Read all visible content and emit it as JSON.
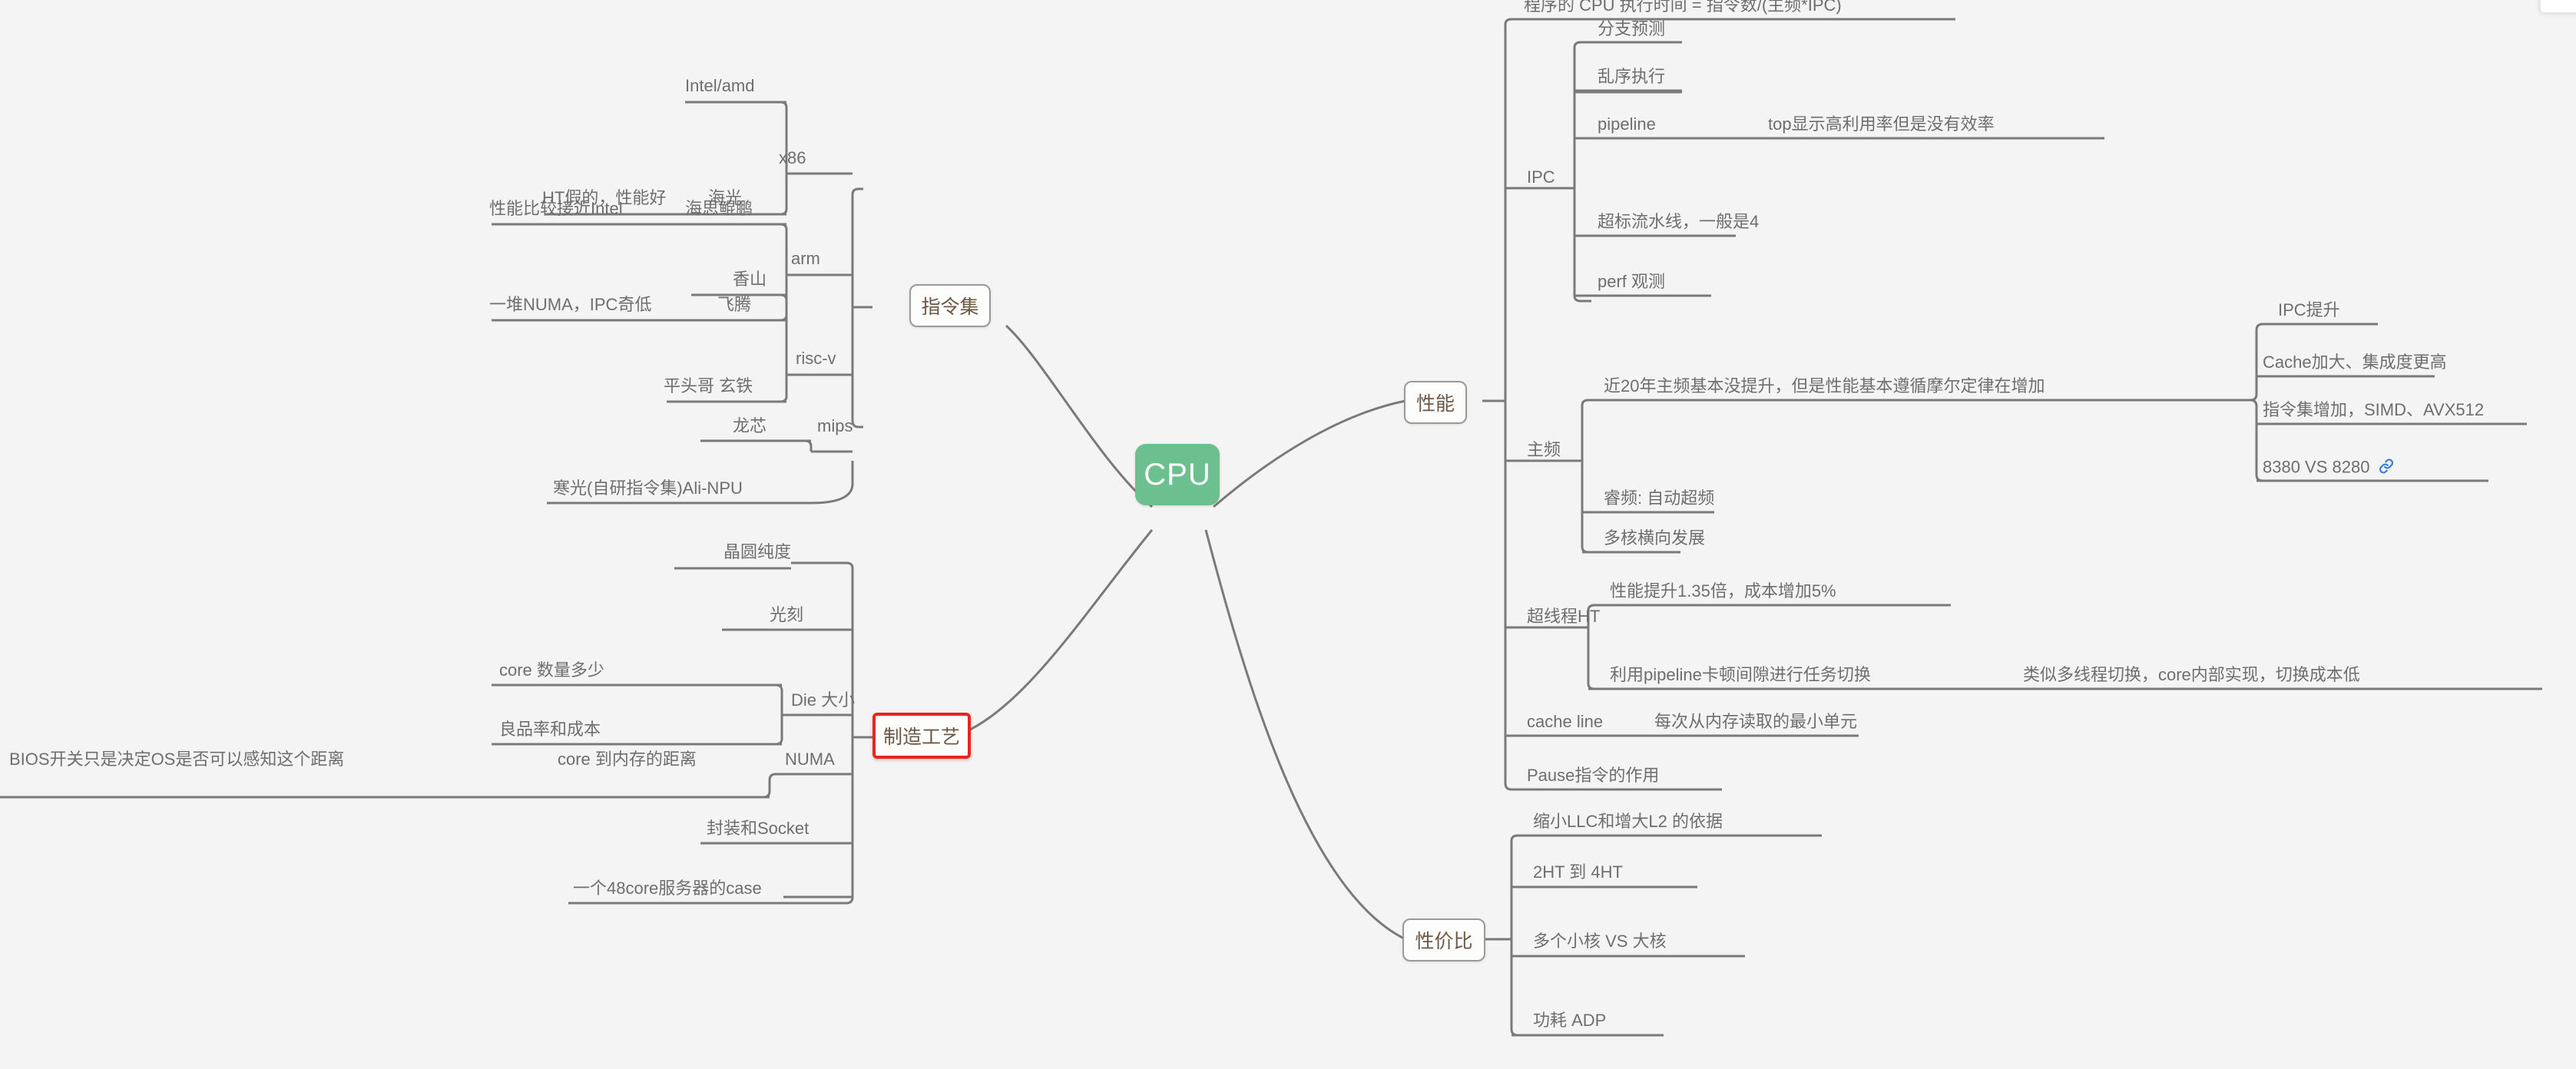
{
  "theme": {
    "background": "#f4f4f4",
    "root_fill": "#6cbf8e",
    "root_text": "#ffffff",
    "topic_text": "#6b5846",
    "topic_border": "#9a9a9a",
    "leaf_text": "#6e6e6e",
    "wire": "#7a7a7a",
    "highlight_border": "#e8251f",
    "link_icon_color": "#3b7ddd"
  },
  "root": {
    "label": "CPU"
  },
  "branches": {
    "instruction_set": {
      "label": "指令集",
      "children": [
        {
          "label": "x86",
          "children": [
            {
              "label": "Intel/amd"
            },
            {
              "label": "海光",
              "note": "HT假的，性能好"
            }
          ]
        },
        {
          "label": "arm",
          "children": [
            {
              "label": "海思鲲鹏",
              "note": "性能比较接近Intel"
            },
            {
              "label": "飞腾",
              "note": "一堆NUMA，IPC奇低"
            }
          ]
        },
        {
          "label": "risc-v",
          "children": [
            {
              "label": "香山"
            },
            {
              "label": "平头哥 玄铁"
            }
          ]
        },
        {
          "label": "mips",
          "children": [
            {
              "label": "龙芯"
            }
          ]
        },
        {
          "label": "寒光(自研指令集)Ali-NPU"
        }
      ]
    },
    "manufacturing": {
      "label": "制造工艺",
      "highlighted": true,
      "children": [
        {
          "label": "晶圆纯度"
        },
        {
          "label": "光刻"
        },
        {
          "label": "Die 大小",
          "children": [
            {
              "label": "core 数量多少"
            },
            {
              "label": "良品率和成本"
            }
          ]
        },
        {
          "label": "NUMA",
          "children": [
            {
              "label": "core 到内存的距离",
              "note": "BIOS开关只是决定OS是否可以感知这个距离"
            }
          ]
        },
        {
          "label": "封装和Socket"
        },
        {
          "label": "一个48core服务器的case"
        }
      ]
    },
    "performance": {
      "label": "性能",
      "children": [
        {
          "label": "程序的 CPU 执行时间 = 指令数/(主频*IPC)"
        },
        {
          "label": "IPC",
          "children": [
            {
              "label": "分支预测"
            },
            {
              "label": "乱序执行"
            },
            {
              "label": "pipeline",
              "note": "top显示高利用率但是没有效率"
            },
            {
              "label": "超标流水线，一般是4"
            },
            {
              "label": "perf 观测"
            }
          ]
        },
        {
          "label": "主频",
          "children": [
            {
              "label": "近20年主频基本没提升，但是性能基本遵循摩尔定律在增加",
              "children": [
                {
                  "label": "IPC提升"
                },
                {
                  "label": "Cache加大、集成度更高"
                },
                {
                  "label": "指令集增加，SIMD、AVX512"
                },
                {
                  "label": "8380 VS 8280",
                  "icon": "link-icon"
                }
              ]
            },
            {
              "label": "睿频: 自动超频"
            },
            {
              "label": "多核横向发展"
            }
          ]
        },
        {
          "label": "超线程HT",
          "children": [
            {
              "label": "性能提升1.35倍，成本增加5%"
            },
            {
              "label": "利用pipeline卡顿间隙进行任务切换",
              "note": "类似多线程切换，core内部实现，切换成本低"
            }
          ]
        },
        {
          "label": "cache line",
          "note": "每次从内存读取的最小单元"
        },
        {
          "label": "Pause指令的作用"
        }
      ]
    },
    "cost_performance": {
      "label": "性价比",
      "children": [
        {
          "label": "缩小LLC和增大L2 的依据"
        },
        {
          "label": "2HT 到 4HT"
        },
        {
          "label": "多个小核 VS 大核"
        },
        {
          "label": "功耗 ADP"
        }
      ]
    }
  }
}
